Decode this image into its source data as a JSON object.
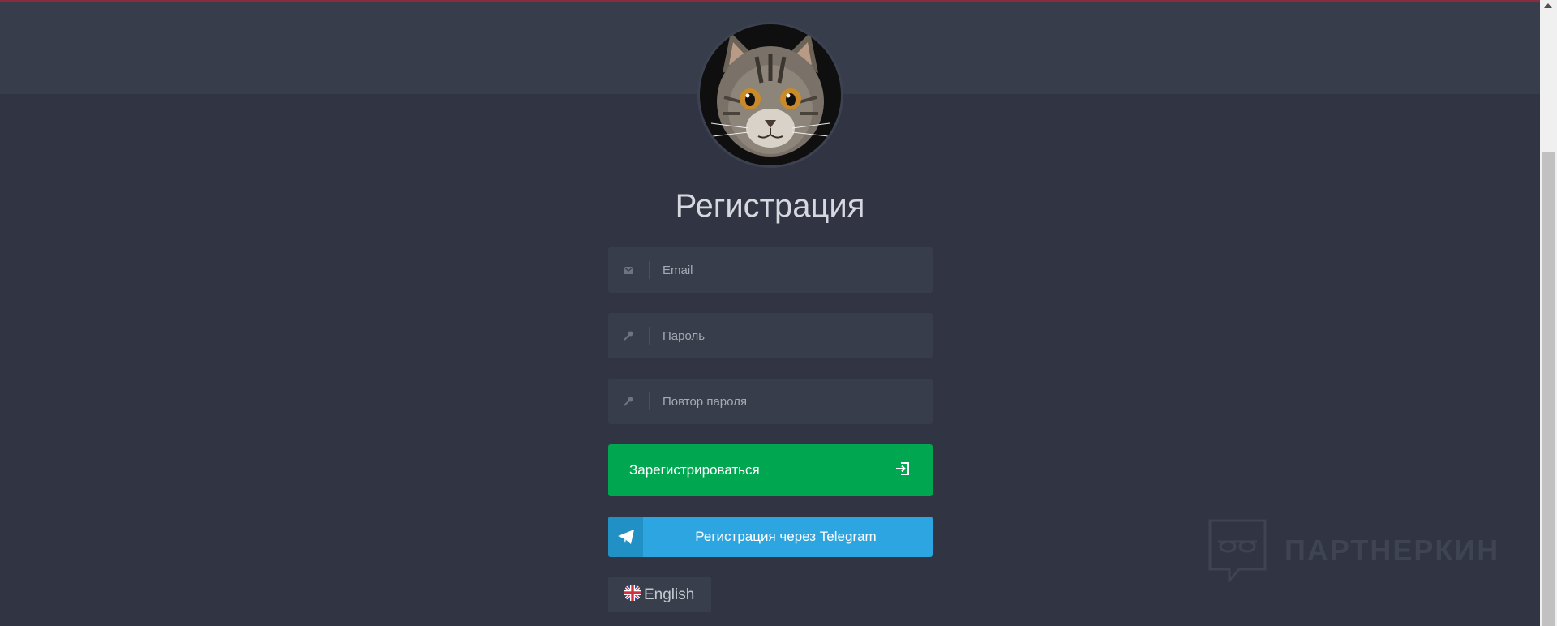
{
  "page": {
    "title": "Регистрация"
  },
  "form": {
    "email_placeholder": "Email",
    "password_placeholder": "Пароль",
    "password_repeat_placeholder": "Повтор пароля",
    "register_button_label": "Зарегистрироваться",
    "telegram_button_label": "Регистрация через Telegram"
  },
  "language": {
    "selected": "English"
  },
  "watermark": {
    "text": "ПАРТНЕРКИН"
  },
  "icons": {
    "email": "envelope-icon",
    "password": "key-icon",
    "password_repeat": "key-icon",
    "register": "login-icon",
    "telegram": "telegram-icon",
    "language": "uk-flag-icon"
  },
  "colors": {
    "background": "#313543",
    "header_band": "#373d4a",
    "register_button": "#00a650",
    "telegram_button": "#2ca5e0"
  }
}
